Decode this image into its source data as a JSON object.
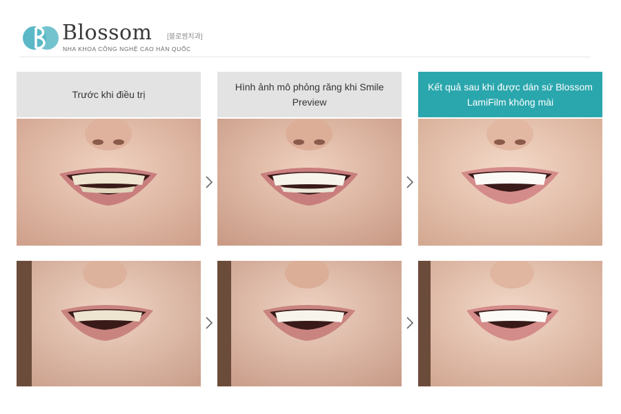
{
  "brand": {
    "name": "Blossom",
    "korean": "[블로썸치과]",
    "tagline": "NHA KHOA CÔNG NGHỆ CAO HÀN QUỐC",
    "color": "#5bb8c6"
  },
  "columns": [
    {
      "label": "Trước khi điều trị"
    },
    {
      "label": "Hình ảnh mô phỏng răng khi Smile Preview"
    },
    {
      "label": "Kết quả sau khi được dán sứ Blossom LamiFilm không mài"
    }
  ],
  "colors": {
    "header_gray": "#e3e3e3",
    "header_teal": "#2aa7ad",
    "skin": "#e8c4b0",
    "lip": "#c97e7e"
  }
}
